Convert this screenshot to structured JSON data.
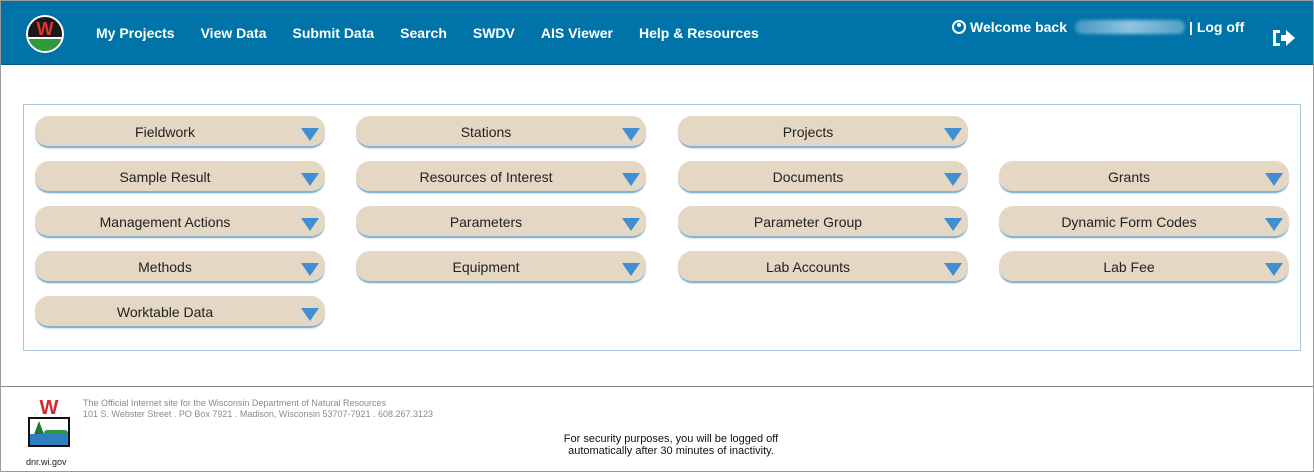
{
  "header": {
    "logo_icon": "wi-dnr-logo-icon",
    "nav": [
      "My Projects",
      "View Data",
      "Submit Data",
      "Search",
      "SWDV",
      "AIS Viewer",
      "Help & Resources"
    ],
    "welcome_label": "Welcome back",
    "logoff_label": "| Log off",
    "icons": {
      "user": "user-circle-icon",
      "logoff": "logoff-arrow-icon"
    },
    "accent_color": "#0073a8"
  },
  "menus": [
    [
      "Fieldwork",
      "Stations",
      "Projects",
      ""
    ],
    [
      "Sample Result",
      "Resources of Interest",
      "Documents",
      "Grants"
    ],
    [
      "Management Actions",
      "Parameters",
      "Parameter Group",
      "Dynamic Form Codes"
    ],
    [
      "Methods",
      "Equipment",
      "Lab Accounts",
      "Lab Fee"
    ],
    [
      "Worktable Data",
      "",
      "",
      ""
    ]
  ],
  "menu_colors": {
    "button": "#e4d8c4",
    "arrow": "#3f8fd2",
    "underline": "#7fb6d6"
  },
  "footer": {
    "site_line": "The Official Internet site for the Wisconsin Department of Natural Resources",
    "address_line": "101 S. Webster Street . PO Box 7921 . Madison, Wisconsin 53707-7921 . 608.267.3123",
    "url": "dnr.wi.gov",
    "security_line1": "For security purposes, you will be logged off",
    "security_line2": "automatically after 30 minutes of inactivity."
  }
}
